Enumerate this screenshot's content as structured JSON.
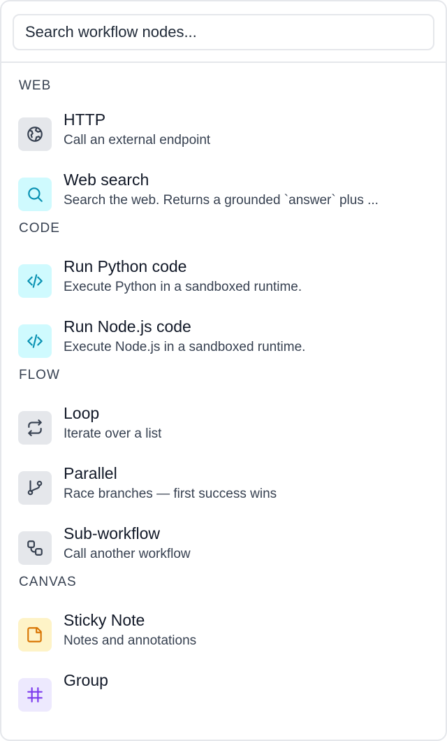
{
  "search": {
    "placeholder": "Search workflow nodes..."
  },
  "sections": [
    {
      "title": "WEB",
      "items": [
        {
          "title": "HTTP",
          "desc": "Call an external endpoint",
          "icon": "globe-icon"
        },
        {
          "title": "Web search",
          "desc": "Search the web. Returns a grounded `answer` plus ...",
          "icon": "search-icon"
        }
      ]
    },
    {
      "title": "CODE",
      "items": [
        {
          "title": "Run Python code",
          "desc": "Execute Python in a sandboxed runtime.",
          "icon": "code-icon"
        },
        {
          "title": "Run Node.js code",
          "desc": "Execute Node.js in a sandboxed runtime.",
          "icon": "code-icon"
        }
      ]
    },
    {
      "title": "FLOW",
      "items": [
        {
          "title": "Loop",
          "desc": "Iterate over a list",
          "icon": "repeat-icon"
        },
        {
          "title": "Parallel",
          "desc": "Race branches — first success wins",
          "icon": "branch-icon"
        },
        {
          "title": "Sub-workflow",
          "desc": "Call another workflow",
          "icon": "workflow-icon"
        }
      ]
    },
    {
      "title": "CANVAS",
      "items": [
        {
          "title": "Sticky Note",
          "desc": "Notes and annotations",
          "icon": "note-icon"
        },
        {
          "title": "Group",
          "desc": "",
          "icon": "group-icon"
        }
      ]
    }
  ]
}
